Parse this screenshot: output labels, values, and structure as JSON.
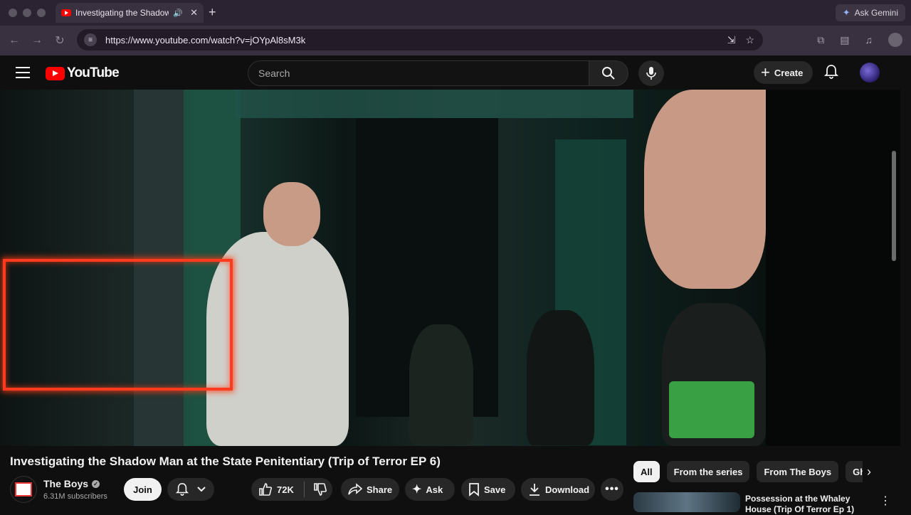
{
  "browser": {
    "tab_title": "Investigating the Shadow Man at the State Penitentiary (Trip of Terror EP 6) - YouTube",
    "tab_title_visible": "Investigating the Shadow",
    "new_tab": "+",
    "ask_gemini": "Ask Gemini",
    "url": "https://www.youtube.com/watch?v=jOYpAl8sM3k"
  },
  "yt": {
    "logo_text": "YouTube",
    "search_placeholder": "Search",
    "create_label": "Create"
  },
  "video": {
    "title": "Investigating the Shadow Man at the State Penitentiary (Trip of Terror EP 6)",
    "channel": {
      "name": "The Boys",
      "subscribers": "6.31M subscribers"
    },
    "actions": {
      "join": "Join",
      "likes": "72K",
      "share": "Share",
      "ask": "Ask",
      "save": "Save",
      "download": "Download"
    }
  },
  "sidebar": {
    "chips": [
      "All",
      "From the series",
      "From The Boys",
      "Ghos"
    ],
    "recommendation": {
      "title": "Possession at the Whaley House (Trip Of Terror Ep 1)"
    }
  },
  "colors": {
    "yt_red": "#ff0000",
    "background": "#0f0f0f",
    "frame_glow": "#ff3b1f"
  },
  "icons": [
    "hamburger-icon",
    "search-icon",
    "mic-icon",
    "plus-icon",
    "bell-icon",
    "like-icon",
    "dislike-icon",
    "share-icon",
    "sparkle-icon",
    "save-icon",
    "download-icon",
    "more-icon",
    "chevron-right-icon"
  ]
}
